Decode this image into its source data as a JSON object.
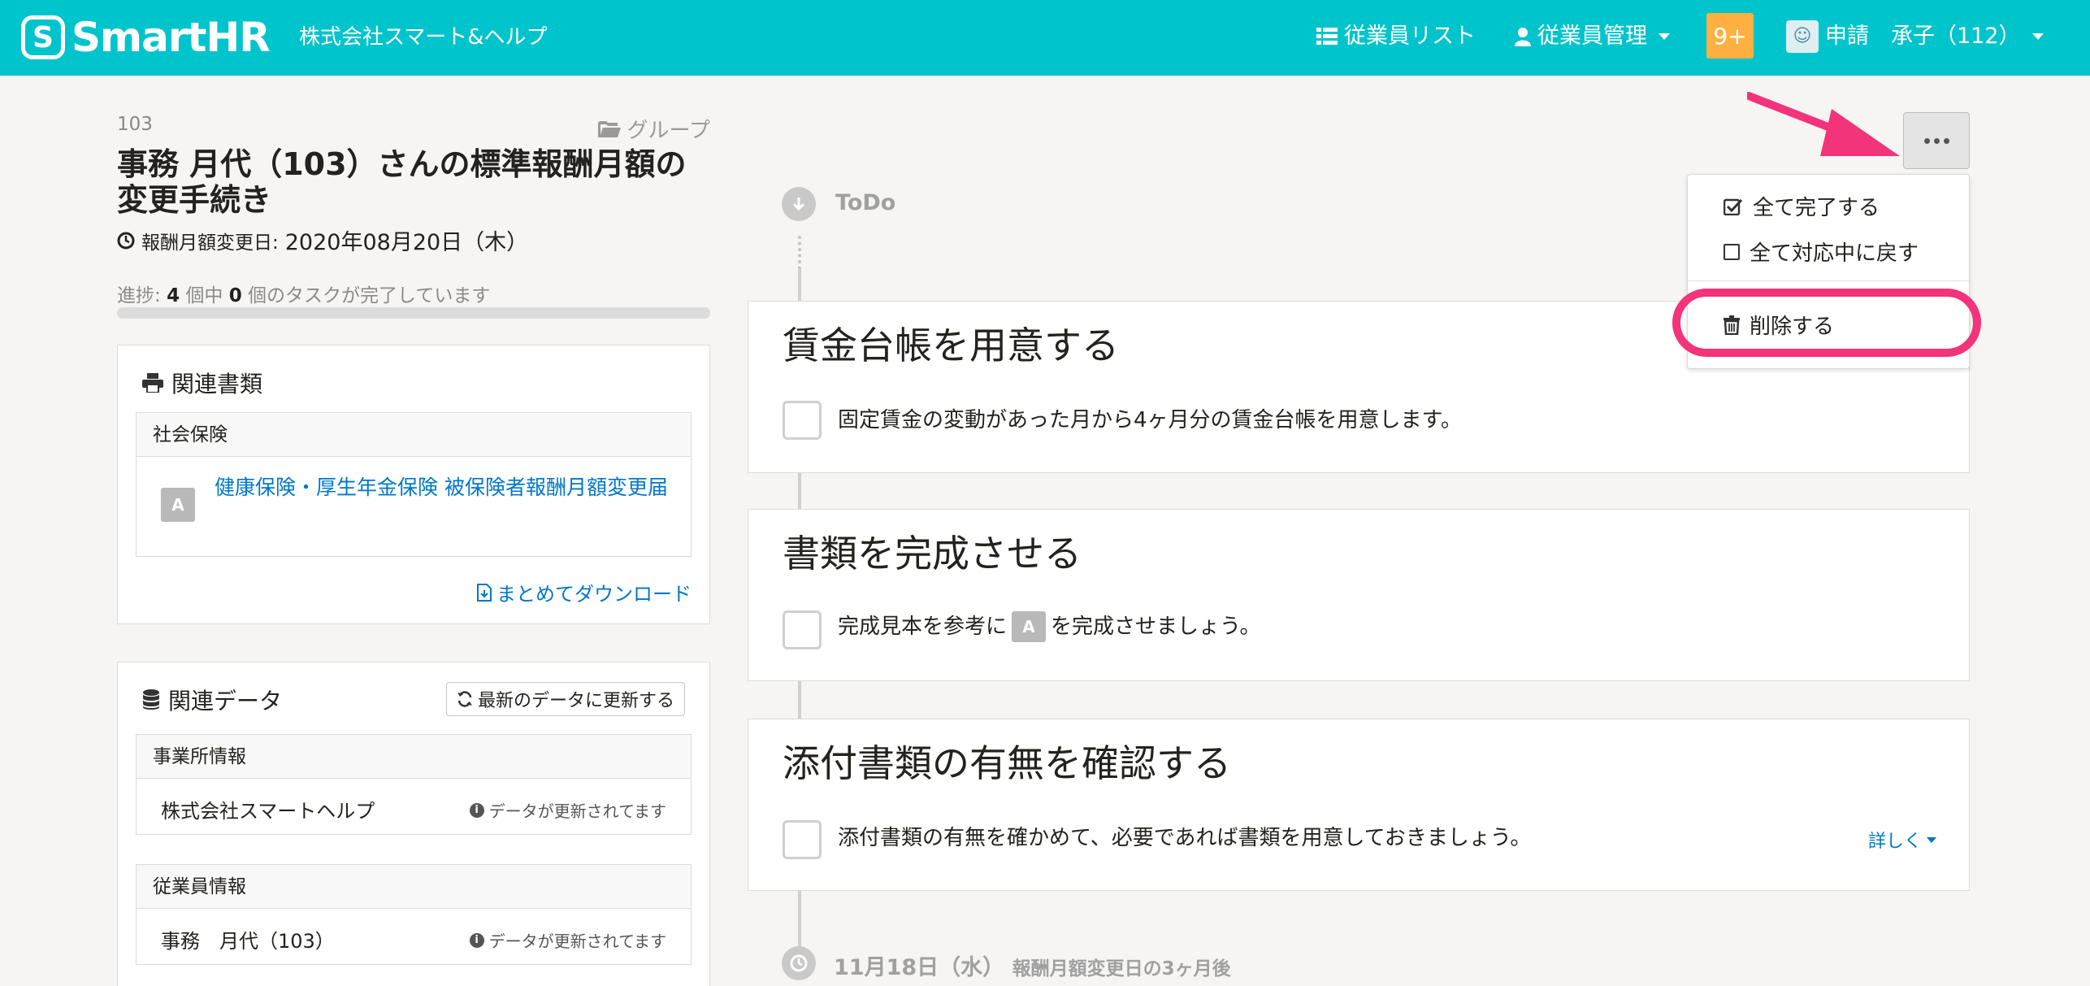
{
  "header": {
    "logo_mark": "S",
    "logo_text": "SmartHR",
    "company": "株式会社スマート&ヘルプ",
    "nav_list": "従業員リスト",
    "nav_manage": "従業員管理",
    "badge": "9+",
    "user_name": "申請　承子（112）"
  },
  "employee": {
    "number": "103",
    "group": "グループ",
    "title": "事務 月代（103）さんの標準報酬月額の変更手続き",
    "date_label": "報酬月額変更日:",
    "date_value": "2020年08月20日（木）",
    "progress_prefix": "進捗:",
    "progress_total": "4",
    "progress_mid": "個中",
    "progress_done": "0",
    "progress_suffix": "個のタスクが完了しています",
    "progress_fraction": 0
  },
  "docs": {
    "title": "関連書類",
    "section": "社会保険",
    "badge": "A",
    "link": "健康保険・厚生年金保険 被保険者報酬月額変更届",
    "download": "まとめてダウンロード"
  },
  "data": {
    "title": "関連データ",
    "refresh": "最新のデータに更新する",
    "office_head": "事業所情報",
    "office_value": "株式会社スマートヘルプ",
    "office_note": "データが更新されてます",
    "emp_head": "従業員情報",
    "emp_value": "事務　月代（103）",
    "emp_note": "データが更新されてます"
  },
  "timeline": {
    "todo": "ToDo",
    "next_date": "11月18日（水）",
    "next_note": "報酬月額変更日の3ヶ月後"
  },
  "tasks": [
    {
      "title": "賃金台帳を用意する",
      "desc": "固定賃金の変動があった月から4ヶ月分の賃金台帳を用意します。"
    },
    {
      "title": "書類を完成させる",
      "desc_before": "完成見本を参考に",
      "badge": "A",
      "desc_after": "を完成させましょう。"
    },
    {
      "title": "添付書類の有無を確認する",
      "desc": "添付書類の有無を確かめて、必要であれば書類を用意しておきましょう。",
      "detail": "詳しく"
    }
  ],
  "menu": {
    "complete_all": "全て完了する",
    "revert_all": "全て対応中に戻す",
    "delete": "削除する"
  },
  "colors": {
    "brand": "#00c4cc",
    "badge": "#ffb040",
    "link": "#0077c7",
    "annotation": "#f3337a"
  }
}
